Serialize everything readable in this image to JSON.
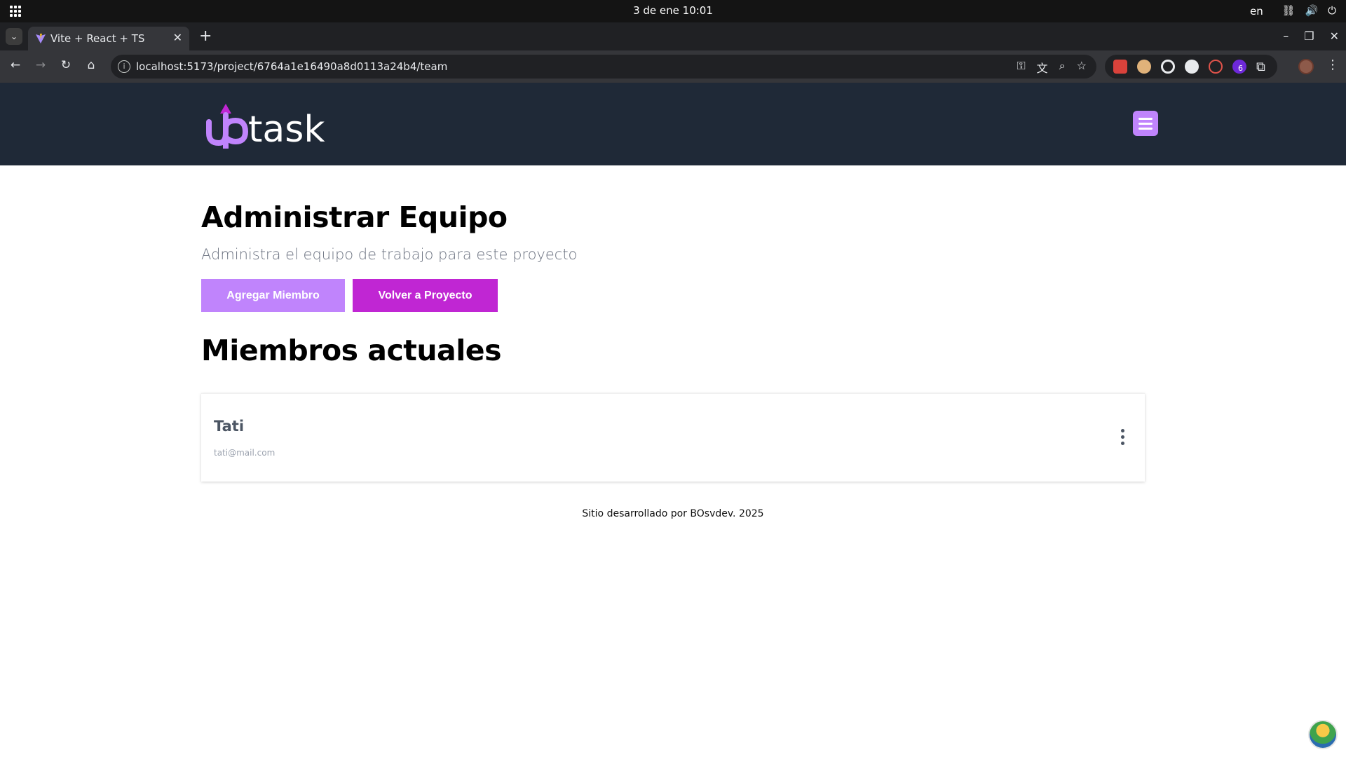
{
  "os": {
    "datetime": "3 de ene  10:01",
    "lang": "en"
  },
  "browser": {
    "tab_title": "Vite + React + TS",
    "url": "localhost:5173/project/6764a1e16490a8d0113a24b4/team",
    "extension_badge": "6"
  },
  "header": {
    "logo_text": "uptask"
  },
  "page": {
    "title": "Administrar Equipo",
    "subtitle": "Administra el equipo de trabajo para este proyecto",
    "add_member_label": "Agregar Miembro",
    "back_label": "Volver a Proyecto",
    "members_title": "Miembros actuales"
  },
  "members": [
    {
      "name": "Tati",
      "email": "tati@mail.com"
    }
  ],
  "footer": {
    "text": "Sitio desarrollado por BOsvdev. 2025"
  },
  "colors": {
    "header_bg": "#1f2937",
    "primary_light": "#c084fc",
    "primary": "#c026d3"
  }
}
